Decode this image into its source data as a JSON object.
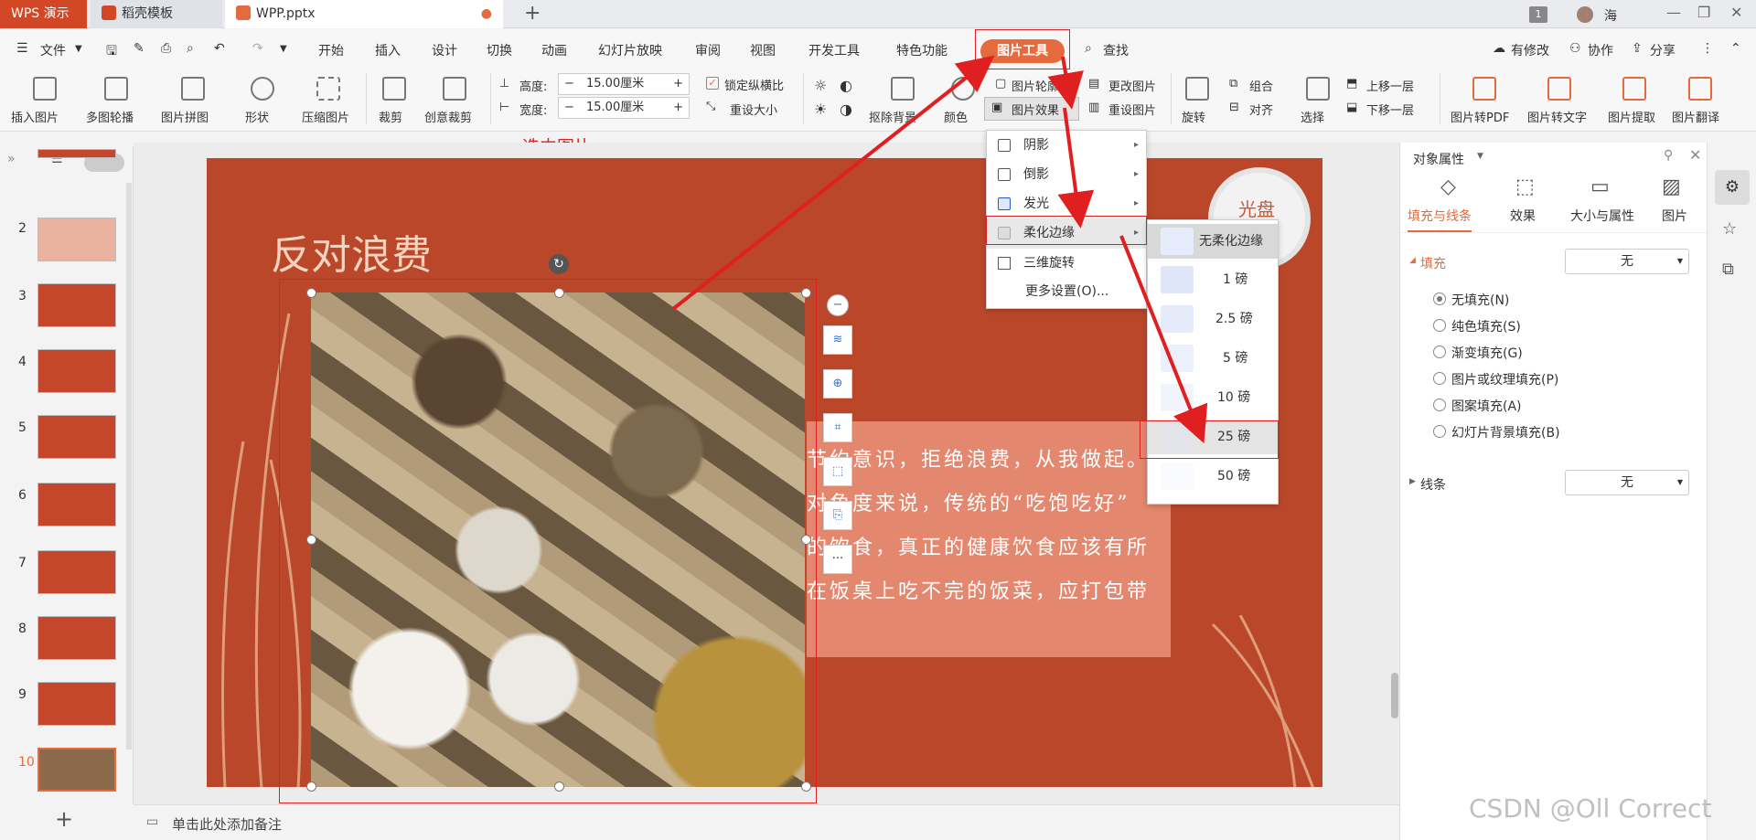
{
  "tabs": {
    "wps": "WPS 演示",
    "daoke": "稻壳模板",
    "doc": "WPP.pptx",
    "add": "+",
    "badge": "1",
    "user": "海"
  },
  "menubar": {
    "file": "文件",
    "items": [
      "开始",
      "插入",
      "设计",
      "切换",
      "动画",
      "幻灯片放映",
      "审阅",
      "视图",
      "开发工具",
      "特色功能"
    ],
    "active_tab": "图片工具",
    "search": "查找",
    "modified": "有修改",
    "collab": "协作",
    "share": "分享"
  },
  "ribbon": {
    "insert_pic": "插入图片",
    "carousel": "多图轮播",
    "collage": "图片拼图",
    "shape": "形状",
    "compress": "压缩图片",
    "crop": "裁剪",
    "creative_crop": "创意裁剪",
    "height_label": "高度:",
    "height_value": "15.00厘米",
    "width_label": "宽度:",
    "width_value": "15.00厘米",
    "lock_ratio": "锁定纵横比",
    "reset_size": "重设大小",
    "remove_bg": "抠除背景",
    "color": "颜色",
    "outline": "图片轮廓",
    "effect": "图片效果",
    "change_pic": "更改图片",
    "reset_pic": "重设图片",
    "rotate": "旋转",
    "group": "组合",
    "align": "对齐",
    "select": "选择",
    "bring_forward": "上移一层",
    "send_backward": "下移一层",
    "to_pdf": "图片转PDF",
    "to_text": "图片转文字",
    "extract": "图片提取",
    "translate": "图片翻译"
  },
  "annotation": "选中图片",
  "effect_menu": {
    "items": [
      {
        "label": "阴影"
      },
      {
        "label": "倒影"
      },
      {
        "label": "发光"
      },
      {
        "label": "柔化边缘"
      },
      {
        "label": "三维旋转"
      },
      {
        "label": "更多设置(O)..."
      }
    ]
  },
  "soften_menu": {
    "items": [
      "无柔化边缘",
      "1 磅",
      "2.5 磅",
      "5 磅",
      "10 磅",
      "25 磅",
      "50 磅"
    ],
    "highlighted": "25 磅"
  },
  "slides": {
    "numbers": [
      "2",
      "3",
      "4",
      "5",
      "6",
      "7",
      "8",
      "9",
      "10"
    ],
    "current": "10",
    "add": "+"
  },
  "slide": {
    "title": "反对浪费",
    "plate_text": "光盘",
    "lines": [
      "节约意识，拒绝浪费，从我做起。",
      "对角度来说，传统的“吃饱吃好”",
      "的饮食，真正的健康饮食应该有所",
      "在饭桌上吃不完的饭菜，应打包带"
    ]
  },
  "float_toolbar": {
    "more": "···"
  },
  "status": {
    "notes": "单击此处添加备注",
    "watermark": "CSDN @Oll Correct"
  },
  "props": {
    "title": "对象属性",
    "tabs": [
      "填充与线条",
      "效果",
      "大小与属性",
      "图片"
    ],
    "fill_label": "填充",
    "fill_value": "无",
    "options": [
      "无填充(N)",
      "纯色填充(S)",
      "渐变填充(G)",
      "图片或纹理填充(P)",
      "图案填充(A)",
      "幻灯片背景填充(B)"
    ],
    "line_label": "线条",
    "line_value": "无"
  },
  "colors": {
    "accent": "#e56a3e",
    "slide_bg": "#bb472b",
    "annot_red": "#e02020"
  }
}
